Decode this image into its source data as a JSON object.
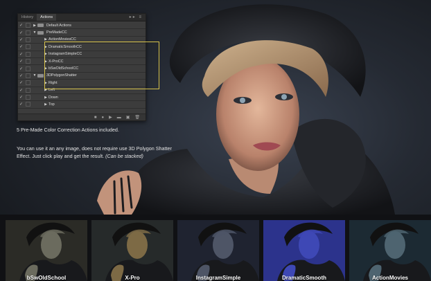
{
  "panel": {
    "tabs": [
      "History",
      "Actions"
    ],
    "tab_icons": "▸▸ ≡",
    "rows": [
      {
        "label": "Default Actions",
        "check": "✓",
        "arrow": "▶",
        "folder": true,
        "indent": 1
      },
      {
        "label": "PreMadeCC",
        "check": "✓",
        "arrow": "▼",
        "folder": true,
        "indent": 1
      },
      {
        "label": "ActionMoviesCC",
        "check": "✓",
        "arrow": "▶",
        "folder": false,
        "indent": 3
      },
      {
        "label": "DramaticSmoothCC",
        "check": "✓",
        "arrow": "▶",
        "folder": false,
        "indent": 3
      },
      {
        "label": "InstagramSimpleCC",
        "check": "✓",
        "arrow": "▶",
        "folder": false,
        "indent": 3
      },
      {
        "label": "X-ProCC",
        "check": "✓",
        "arrow": "▶",
        "folder": false,
        "indent": 3
      },
      {
        "label": "bSwOldSchoolCC",
        "check": "✓",
        "arrow": "▶",
        "folder": false,
        "indent": 3
      },
      {
        "label": "3DPolygonShatter",
        "check": "✓",
        "arrow": "▼",
        "folder": true,
        "indent": 1
      },
      {
        "label": "Right",
        "check": "✓",
        "arrow": "▶",
        "folder": false,
        "indent": 3
      },
      {
        "label": "Left",
        "check": "✓",
        "arrow": "▶",
        "folder": false,
        "indent": 3
      },
      {
        "label": "Down",
        "check": "✓",
        "arrow": "▶",
        "folder": false,
        "indent": 3
      },
      {
        "label": "Top",
        "check": "✓",
        "arrow": "▶",
        "folder": false,
        "indent": 3
      }
    ],
    "footer_icons": [
      "■",
      "●",
      "▶",
      "▬",
      "▣",
      "🗑"
    ]
  },
  "caption": {
    "line1": "5 Pre-Made Color Correction Actions included.",
    "line2": "You can use it an any image, does not require use 3D Polygon Shatter Effect. Just click play and get the result.",
    "line2_note": "(Can be stacked)"
  },
  "thumbnails": [
    {
      "label": "bSwOldSchool",
      "tint": "#6b6b5e",
      "bg": "#2b2b26"
    },
    {
      "label": "X-Pro",
      "tint": "#7d6a45",
      "bg": "#262a2a"
    },
    {
      "label": "InstagramSimple",
      "tint": "#4e5566",
      "bg": "#1f2330"
    },
    {
      "label": "DramaticSmooth",
      "tint": "#3e48b5",
      "bg": "#2c338c"
    },
    {
      "label": "ActionMovies",
      "tint": "#4e6470",
      "bg": "#1c2a33"
    }
  ],
  "colors": {
    "highlight": "#d7c24a",
    "panel_bg": "#3c3c3c",
    "hero_bg": "#252a33"
  }
}
